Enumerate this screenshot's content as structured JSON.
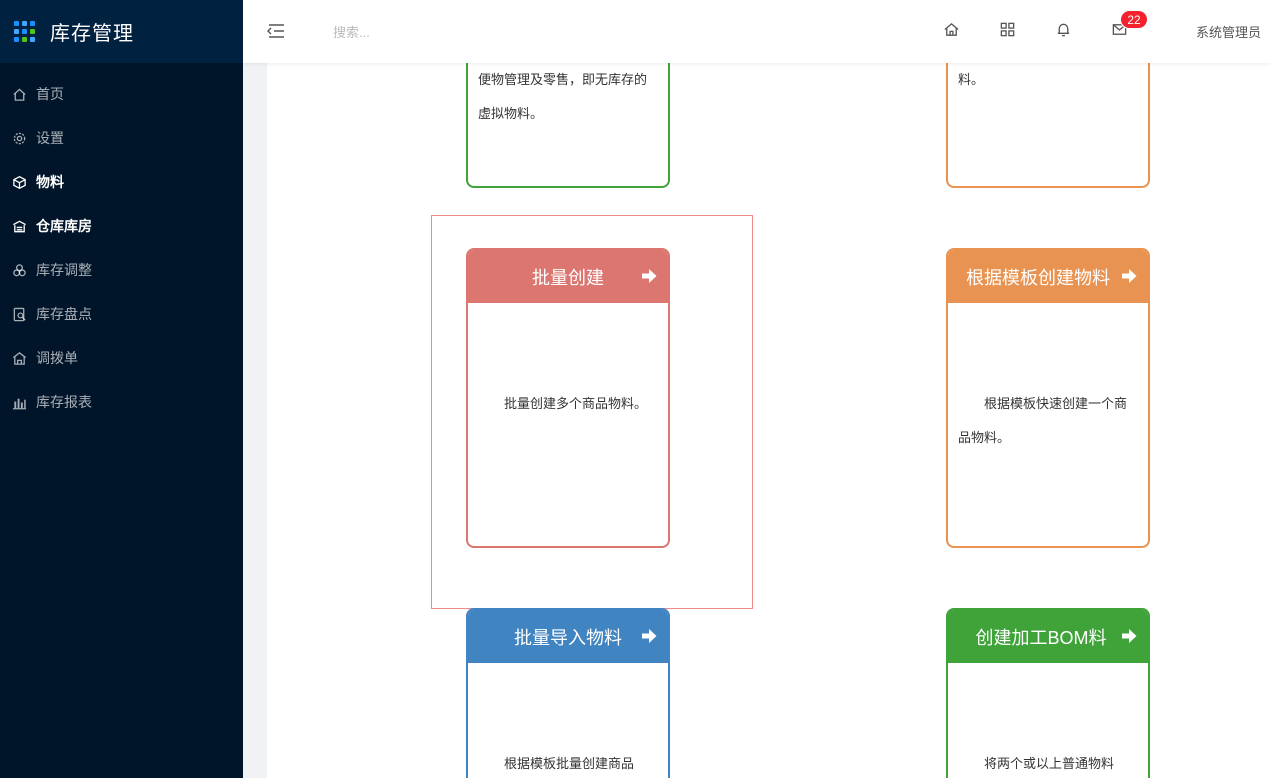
{
  "app": {
    "title": "库存管理"
  },
  "colors": {
    "red": "#db7670",
    "orange": "#e99352",
    "green": "#3fa33a",
    "blue": "#4184c2",
    "badge": "#f5222d"
  },
  "sidebar": {
    "items": [
      {
        "label": "首页",
        "icon": "home-icon"
      },
      {
        "label": "设置",
        "icon": "gear-icon"
      },
      {
        "label": "物料",
        "icon": "cube-icon"
      },
      {
        "label": "仓库库房",
        "icon": "warehouse-icon"
      },
      {
        "label": "库存调整",
        "icon": "adjust-icon"
      },
      {
        "label": "库存盘点",
        "icon": "inventory-check-icon"
      },
      {
        "label": "调拨单",
        "icon": "transfer-icon"
      },
      {
        "label": "库存报表",
        "icon": "bar-chart-icon"
      }
    ]
  },
  "header": {
    "search_placeholder": "搜索...",
    "notification_count": "22",
    "user": "系统管理员"
  },
  "cards": {
    "top_left": {
      "text": "便物管理及零售，即无库存的虚拟物料。"
    },
    "top_right": {
      "text": "料。"
    },
    "batch_create": {
      "title": "批量创建",
      "text": "批量创建多个商品物料。"
    },
    "template_create": {
      "title": "根据模板创建物料",
      "text": "根据模板快速创建一个商品物料。"
    },
    "batch_import": {
      "title": "批量导入物料",
      "text": "根据模板批量创建商品"
    },
    "bom_create": {
      "title": "创建加工BOM料",
      "text": "将两个或以上普通物料"
    }
  }
}
